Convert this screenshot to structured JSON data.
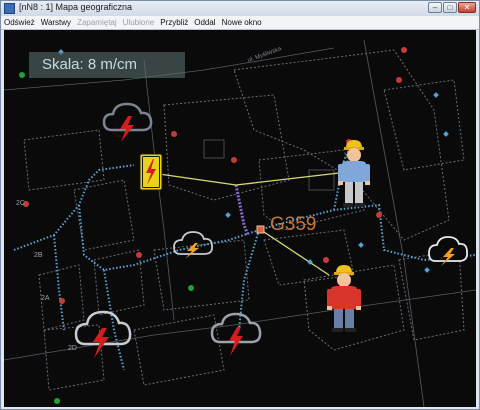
{
  "window": {
    "title": "[nN8 : 1] Mapa geograficzna",
    "buttons": {
      "minimize": "–",
      "maximize": "□",
      "close": "✕"
    }
  },
  "menu": {
    "items": [
      {
        "label": "Odśwież",
        "enabled": true
      },
      {
        "label": "Warstwy",
        "enabled": true
      },
      {
        "label": "Zapamiętaj",
        "enabled": false
      },
      {
        "label": "Ulubione",
        "enabled": false
      },
      {
        "label": "Przybliż",
        "enabled": true
      },
      {
        "label": "Oddal",
        "enabled": true
      },
      {
        "label": "Nowe okno",
        "enabled": true
      }
    ]
  },
  "map": {
    "scale_label": "Skala: 8 m/cm",
    "station_label": "G359",
    "street_label": "ul. Myśliwska",
    "plot_labels": [
      "2C",
      "2B",
      "2A",
      "2D"
    ],
    "colors": {
      "background": "#0a0a0a",
      "connector": "#d9d87a",
      "cable": "#5aa6d6",
      "station": "#c4783c",
      "warning": "#e8d21c",
      "storm_bolt": "#d61c1c",
      "weak_bolt": "#f0a020"
    },
    "icons": [
      "lightning-warning-icon",
      "worker-icon",
      "storm-cloud-icon",
      "cloud-lightning-icon",
      "transformer-station-icon"
    ]
  }
}
